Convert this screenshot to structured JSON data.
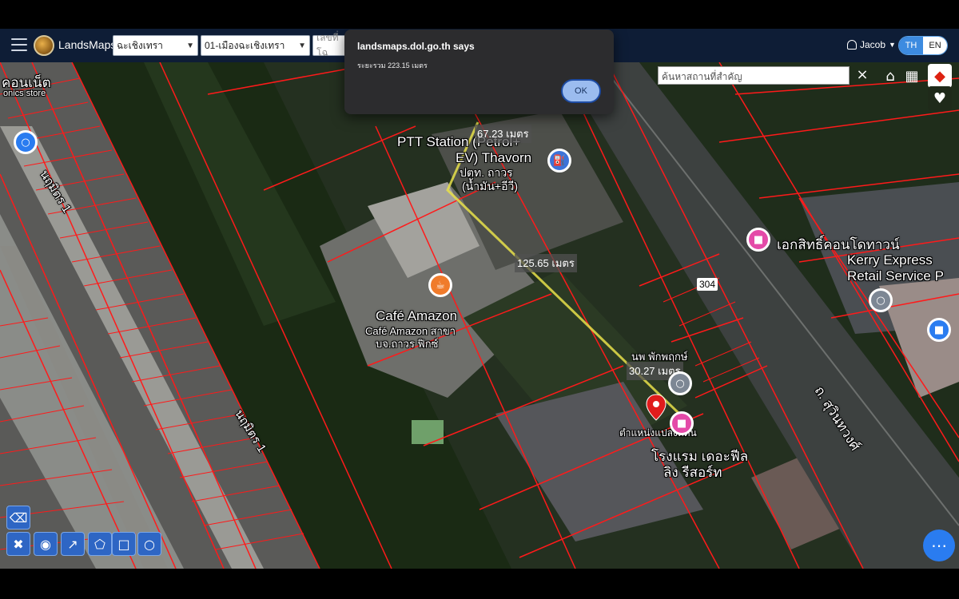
{
  "header": {
    "brand": "LandsMaps",
    "province_select": "ฉะเชิงเทรา",
    "district_select": "01-เมืองฉะเชิงเทรา",
    "parcel_placeholder": "เลขที่โฉ",
    "user_name": "Jacob",
    "lang_th": "TH",
    "lang_en": "EN"
  },
  "search": {
    "placeholder": "ค้นหาสถานที่สำคัญ",
    "close": "×"
  },
  "dialog": {
    "title": "landsmaps.dol.go.th says",
    "message": "ระยะรวม 223.15 เมตร",
    "ok_label": "OK"
  },
  "map": {
    "distances": {
      "d1": "67.23 เมตร",
      "d2": "125.65 เมตร",
      "d3": "30.27 เมตร"
    },
    "labels": {
      "top_left_place": "คอนเน็ต",
      "top_left_sub": "onics store",
      "road_nimitr_1": "นฤมิตร 1",
      "road_nimitr_1b": "นฤมิตร 1",
      "ptt_station": "PTT Station (Petrol+",
      "ptt_station_2": "EV) Thavorn",
      "ptt_thai": "ปตท. ถาวร",
      "ptt_thai_2": "(น้ำมัน+อีวี)",
      "cafe_amazon": "Café Amazon",
      "cafe_amazon_thai": "Café Amazon สาขา",
      "cafe_amazon_thai_2": "บจ.ถาวร ฟิกซ์",
      "condo": "เอกสิทธิ์คอนโดทาวน์",
      "kerry": "Kerry Express",
      "kerry_2": "Retail Service P",
      "route_304": "304",
      "resort_above": "นพ พักพฤกษ์",
      "pin_label": "ตำแหน่งแปลงที่ดิน",
      "hotel": "โรงแรม เดอะฟีล",
      "hotel_2": "ลิง รีสอร์ท",
      "sukhumvit": "ถ. สุวินทวงศ์"
    },
    "accent_color": "#ff1a1a",
    "measure_line_color": "#e8e04a"
  },
  "tools": {
    "eraser_icon": "eraser-icon",
    "icons": [
      "remove-measure-icon",
      "pin-tool-icon",
      "line-tool-icon",
      "polygon-tool-icon",
      "rectangle-tool-icon",
      "circle-tool-icon"
    ]
  }
}
